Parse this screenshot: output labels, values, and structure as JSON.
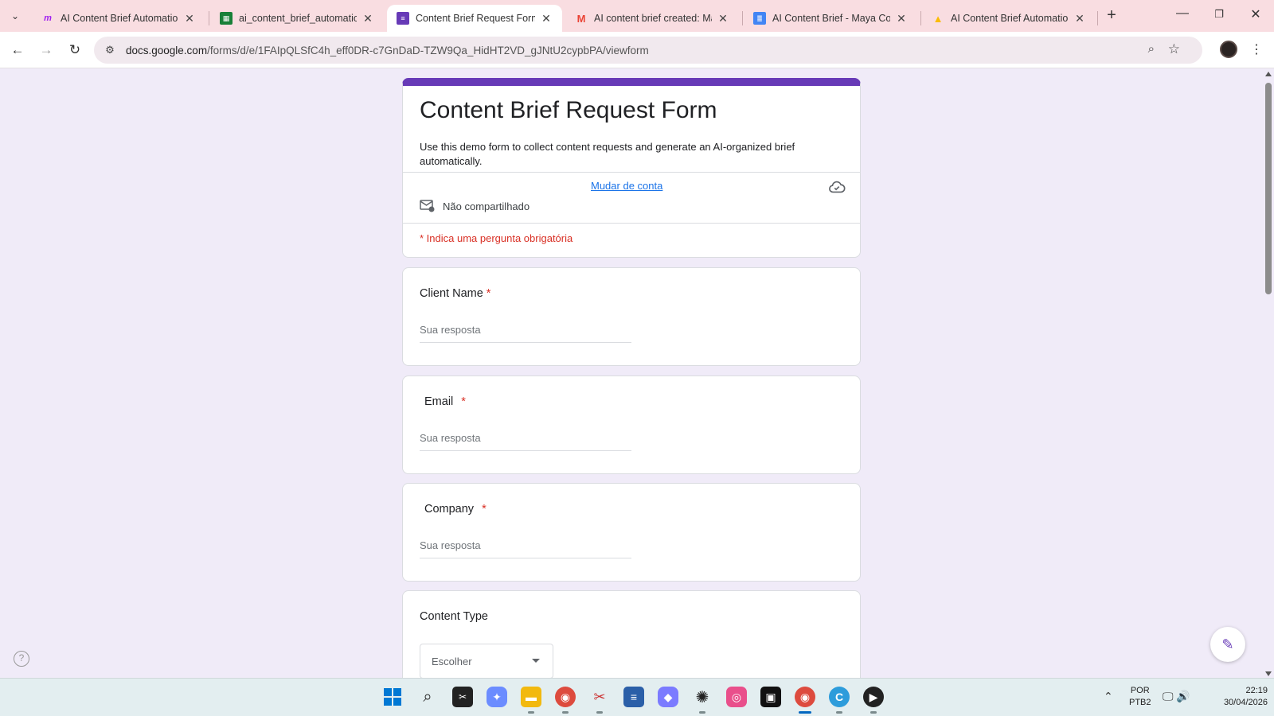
{
  "browser": {
    "tabs": [
      {
        "title": "AI Content Brief Automation",
        "icon": "make-icon",
        "color": "#a020f0"
      },
      {
        "title": "ai_content_brief_automation",
        "icon": "sheets-icon",
        "color": "#188038"
      },
      {
        "title": "Content Brief Request Form",
        "icon": "forms-icon",
        "color": "#673ab7"
      },
      {
        "title": "AI content brief created: May",
        "icon": "gmail-icon",
        "color": "#ea4335"
      },
      {
        "title": "AI Content Brief - Maya Colli",
        "icon": "docs-icon",
        "color": "#4285f4"
      },
      {
        "title": "AI Content Brief Automation",
        "icon": "drive-icon",
        "color": "#fbbc04"
      }
    ],
    "active_tab": 2,
    "url_host": "docs.google.com",
    "url_path": "/forms/d/e/1FAIpQLSfC4h_eff0DR-c7GnDaD-TZW9Qa_HidHT2VD_gJNtU2cypbPA/viewform"
  },
  "form": {
    "title": "Content Brief Request Form",
    "description": "Use this demo form to collect content requests and generate an AI-organized brief automatically.",
    "switch_account": "Mudar de conta",
    "not_shared": "Não compartilhado",
    "required_note": "* Indica uma pergunta obrigatória",
    "questions": [
      {
        "label": "Client Name",
        "required_mark": "*",
        "placeholder": "Sua resposta"
      },
      {
        "label": "Email",
        "required_mark": "*",
        "placeholder": "Sua resposta"
      },
      {
        "label": "Company",
        "required_mark": "*",
        "placeholder": "Sua resposta"
      },
      {
        "label": "Content Type",
        "select_value": "Escolher"
      }
    ]
  },
  "taskbar": {
    "lang_top": "POR",
    "lang_bottom": "PTB2",
    "time": "22:19",
    "date": "30/04/2026"
  },
  "theme": {
    "accent": "#673ab7",
    "background": "#f0ebf8",
    "required": "#d93025",
    "link": "#1a73e8"
  }
}
